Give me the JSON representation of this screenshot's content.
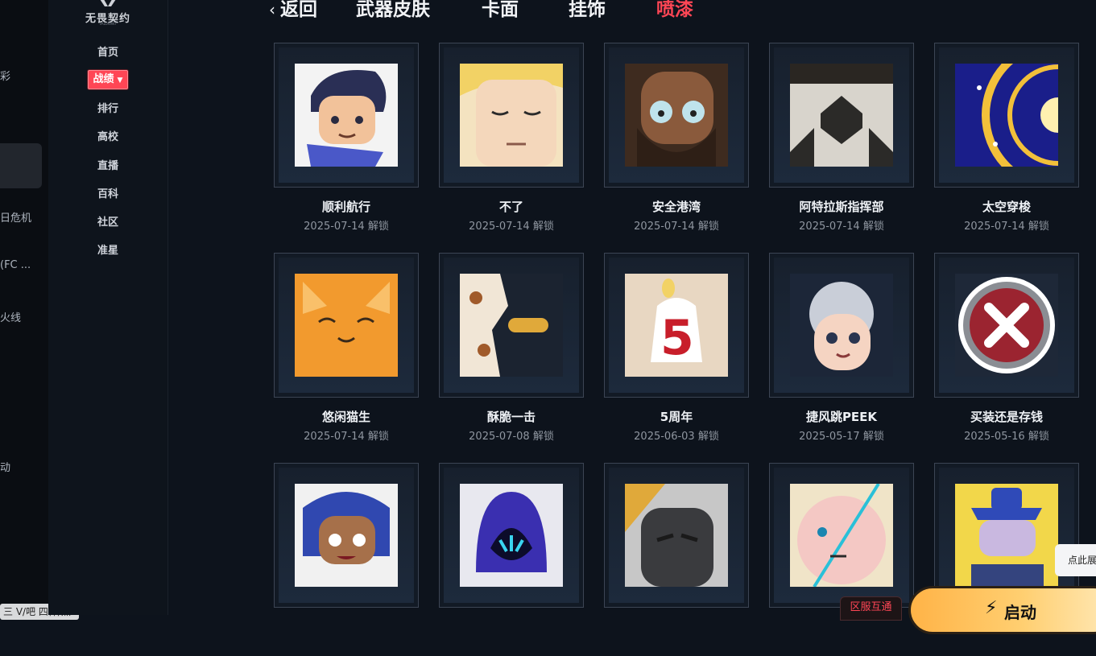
{
  "left_rail": {
    "items": [
      "彩",
      "日危机",
      "(FC ...",
      "火线",
      "动"
    ]
  },
  "tooltip": "三 V/吧 四件/然",
  "logo": {
    "text": "无畏契约",
    "sub": "VALORANT"
  },
  "nav": {
    "items": [
      {
        "label": "首页"
      },
      {
        "label": "战绩",
        "active": true,
        "caret": "▼"
      },
      {
        "label": "排行"
      },
      {
        "label": "高校"
      },
      {
        "label": "直播"
      },
      {
        "label": "百科"
      },
      {
        "label": "社区"
      },
      {
        "label": "准星"
      }
    ]
  },
  "tabs": {
    "back": "返回",
    "items": [
      {
        "label": "武器皮肤"
      },
      {
        "label": "卡面"
      },
      {
        "label": "挂饰"
      },
      {
        "label": "喷漆",
        "active": true
      }
    ]
  },
  "sprays": [
    {
      "title": "顺利航行",
      "date": "2025-07-14 解锁",
      "icon": "agent-face-icon"
    },
    {
      "title": "不了",
      "date": "2025-07-14 解锁",
      "icon": "blonde-face-icon"
    },
    {
      "title": "安全港湾",
      "date": "2025-07-14 解锁",
      "icon": "bearded-face-icon"
    },
    {
      "title": "阿特拉斯指挥部",
      "date": "2025-07-14 解锁",
      "icon": "hexagon-symbol-icon"
    },
    {
      "title": "太空穿梭",
      "date": "2025-07-14 解锁",
      "icon": "space-gate-icon"
    },
    {
      "title": "悠闲猫生",
      "date": "2025-07-14 解锁",
      "icon": "orange-cat-icon"
    },
    {
      "title": "酥脆一击",
      "date": "2025-07-08 解锁",
      "icon": "bullet-impact-icon"
    },
    {
      "title": "5周年",
      "date": "2025-06-03 解锁",
      "icon": "birthday-candle-icon"
    },
    {
      "title": "捷风跳PEEK",
      "date": "2025-05-17 解锁",
      "icon": "jett-peek-icon"
    },
    {
      "title": "买装还是存钱",
      "date": "2025-05-16 解锁",
      "icon": "red-x-icon"
    },
    {
      "title": "",
      "date": "",
      "icon": "blue-hair-girl-icon"
    },
    {
      "title": "",
      "date": "",
      "icon": "hooded-figure-icon"
    },
    {
      "title": "",
      "date": "",
      "icon": "dark-helmet-icon"
    },
    {
      "title": "",
      "date": "",
      "icon": "scarred-face-icon"
    },
    {
      "title": "",
      "date": "",
      "icon": "cowboy-hat-icon"
    }
  ],
  "region_badge": "区服互通",
  "launch": {
    "label": "启动"
  },
  "side_tip": "点此展"
}
